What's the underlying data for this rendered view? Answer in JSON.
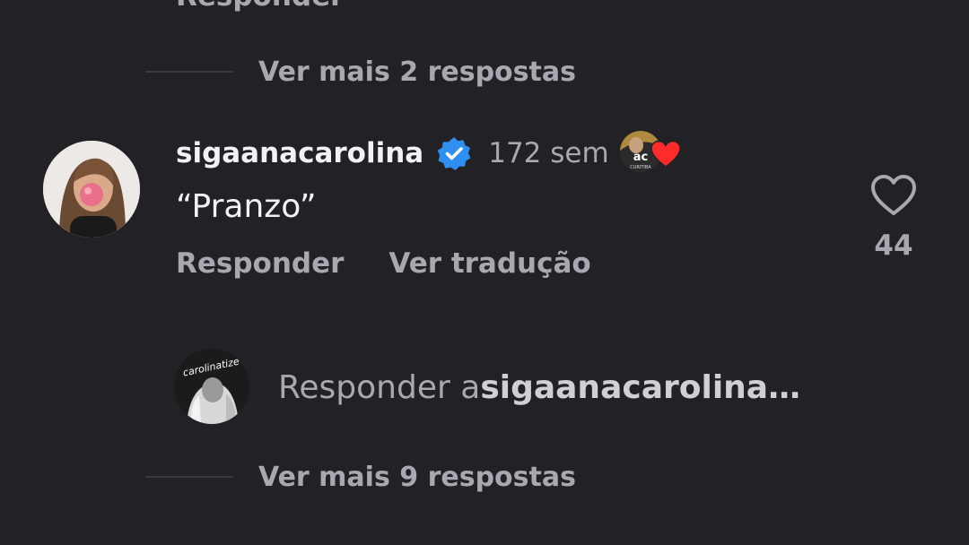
{
  "top": {
    "cutoff_action": "Responder",
    "view_more_replies": "Ver mais 2 respostas"
  },
  "comment": {
    "username": "sigaanacarolina",
    "verified": true,
    "time": "172 sem",
    "text": "“Pranzo”",
    "creator_badge_initials": "ac",
    "creator_badge_subtitle": "CURITIBA",
    "actions": {
      "reply": "Responder",
      "translate": "Ver tradução"
    },
    "like_count": "44"
  },
  "composer": {
    "placeholder_prefix": "Responder a ",
    "placeholder_target": "sigaanacarolina…",
    "my_avatar_text": "carolinatize"
  },
  "bottom": {
    "view_more_replies": "Ver mais 9 respostas"
  },
  "colors": {
    "background": "#212126",
    "primary_text": "#f2f2f5",
    "secondary_text": "#a8a9b0",
    "verified_blue": "#2f8ff0",
    "heart_red": "#ff2a2a"
  },
  "icons": {
    "verified": "verified-badge-icon",
    "like": "heart-outline-icon",
    "creator_like": "heart-filled-icon"
  }
}
